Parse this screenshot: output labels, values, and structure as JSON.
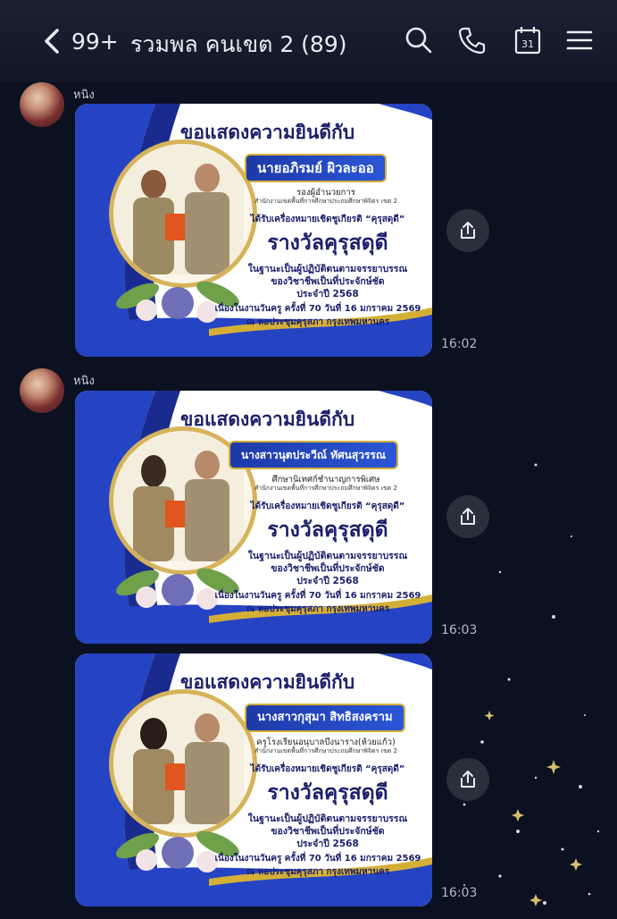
{
  "header": {
    "back_count": "99+",
    "title": "รวมพล คนเขต 2 (89)",
    "calendar_day": "31",
    "icons": [
      "chevron-left-icon",
      "search-icon",
      "phone-icon",
      "calendar-icon",
      "menu-icon"
    ]
  },
  "colors": {
    "background": "#0b1120",
    "header": "#161d2d",
    "card_navy": "#1b1f6b",
    "card_blue": "#1e3aa8",
    "gold": "#d4af37"
  },
  "messages": [
    {
      "sender": "หนิง",
      "time": "16:02",
      "card": {
        "title": "ขอแสดงความยินดีกับ",
        "name": "นายอภิรมย์  ผิวละออ",
        "position": "รองผู้อำนวยการ",
        "org": "สำนักงานเขตพื้นที่การศึกษาประถมศึกษาพิจิตร เขต 2",
        "award_line": "ได้รับเครื่องหมายเชิดชูเกียรติ “คุรุสดุดี”",
        "award_big": "รางวัลคุรุสดุดี",
        "role1": "ในฐานะเป็นผู้ปฏิบัติตนตามจรรยาบรรณ",
        "role2": "ของวิชาชีพเป็นที่ประจักษ์ชัด",
        "role3": "ประจำปี 2568",
        "event1": "เนื่องในงานวันครู ครั้งที่ 70 วันที่ 16 มกราคม 2569",
        "event2": "ณ หอประชุมคุรุสภา กรุงเทพมหานคร"
      }
    },
    {
      "sender": "หนิง",
      "time": "16:03",
      "card": {
        "title": "ขอแสดงความยินดีกับ",
        "name": "นางสาวนุตประวีณ์  ทัศนสุวรรณ",
        "position": "ศึกษานิเทศก์ชำนาญการพิเศษ",
        "org": "สำนักงานเขตพื้นที่การศึกษาประถมศึกษาพิจิตร เขต 2",
        "award_line": "ได้รับเครื่องหมายเชิดชูเกียรติ “คุรุสดุดี”",
        "award_big": "รางวัลคุรุสดุดี",
        "role1": "ในฐานะเป็นผู้ปฏิบัติตนตามจรรยาบรรณ",
        "role2": "ของวิชาชีพเป็นที่ประจักษ์ชัด",
        "role3": "ประจำปี 2568",
        "event1": "เนื่องในงานวันครู ครั้งที่ 70 วันที่ 16 มกราคม 2569",
        "event2": "ณ หอประชุมคุรุสภา กรุงเทพมหานคร"
      }
    },
    {
      "sender": "",
      "time": "16:03",
      "card": {
        "title": "ขอแสดงความยินดีกับ",
        "name": "นางสาวกุสุมา  สิทธิสงคราม",
        "position": "ครูโรงเรียนอนุบาลบึงนาราง(ห้วยแก้ว)",
        "org": "สำนักงานเขตพื้นที่การศึกษาประถมศึกษาพิจิตร เขต 2",
        "award_line": "ได้รับเครื่องหมายเชิดชูเกียรติ “คุรุสดุดี”",
        "award_big": "รางวัลคุรุสดุดี",
        "role1": "ในฐานะเป็นผู้ปฏิบัติตนตามจรรยาบรรณ",
        "role2": "ของวิชาชีพเป็นที่ประจักษ์ชัด",
        "role3": "ประจำปี 2568",
        "event1": "เนื่องในงานวันครู ครั้งที่ 70 วันที่ 16 มกราคม 2569",
        "event2": "ณ หอประชุมคุรุสภา กรุงเทพมหานคร"
      }
    }
  ]
}
